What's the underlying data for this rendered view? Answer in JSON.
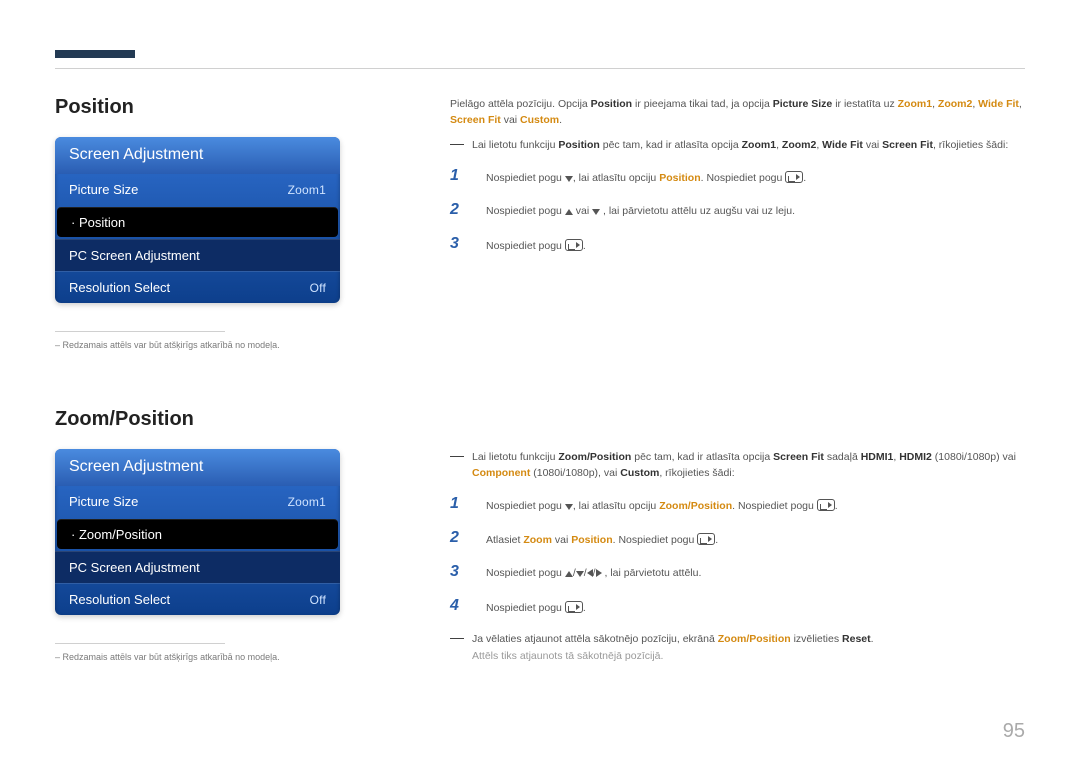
{
  "page_number": "95",
  "position": {
    "heading": "Position",
    "menu": {
      "title": "Screen Adjustment",
      "rows": [
        {
          "label": "Picture Size",
          "value": "Zoom1"
        },
        {
          "label": "· Position",
          "selected": true
        },
        {
          "label": "PC Screen Adjustment"
        },
        {
          "label": "Resolution Select",
          "value": "Off"
        }
      ]
    },
    "image_note": "Redzamais attēls var būt atšķirīgs atkarībā no modeļa.",
    "intro": {
      "t1": "Pielāgo attēla pozīciju. Opcija ",
      "k_position": "Position",
      "t2": " ir pieejama tikai tad, ja opcija ",
      "k_picsize": "Picture Size",
      "t3": " ir iestatīta uz ",
      "k_zoom1": "Zoom1",
      "t4": ", ",
      "k_zoom2": "Zoom2",
      "t5": ", ",
      "k_widefit": "Wide Fit",
      "t6": ", ",
      "k_screenfit": "Screen Fit",
      "t7": " vai ",
      "k_custom": "Custom",
      "t8": "."
    },
    "dash_note": {
      "t1": "Lai lietotu funkciju ",
      "k_position": "Position",
      "t2": " pēc tam, kad ir atlasīta opcija ",
      "k_zoom1": "Zoom1",
      "t3": ", ",
      "k_zoom2": "Zoom2",
      "t4": ", ",
      "k_widefit": "Wide Fit",
      "t5": " vai ",
      "k_screenfit": "Screen Fit",
      "t6": ", rīkojieties šādi:"
    },
    "steps": [
      {
        "num": "1",
        "pre": "Nospiediet pogu ",
        "mid": ", lai atlasītu opciju ",
        "key": "Position",
        "post": ". Nospiediet pogu ",
        "tail": "."
      },
      {
        "num": "2",
        "pre": "Nospiediet pogu ",
        "mid": " vai ",
        "post": " , lai pārvietotu attēlu uz augšu vai uz leju."
      },
      {
        "num": "3",
        "pre": "Nospiediet pogu ",
        "tail": "."
      }
    ]
  },
  "zoom": {
    "heading": "Zoom/Position",
    "menu": {
      "title": "Screen Adjustment",
      "rows": [
        {
          "label": "Picture Size",
          "value": "Zoom1"
        },
        {
          "label": "· Zoom/Position",
          "selected": true
        },
        {
          "label": "PC Screen Adjustment"
        },
        {
          "label": "Resolution Select",
          "value": "Off"
        }
      ]
    },
    "image_note": "Redzamais attēls var būt atšķirīgs atkarībā no modeļa.",
    "dash_note": {
      "t1": "Lai lietotu funkciju ",
      "k_zp": "Zoom/Position",
      "t2": " pēc tam, kad ir atlasīta opcija ",
      "k_sf": "Screen Fit",
      "t3": " sadaļā ",
      "k_h1": "HDMI1",
      "c1": ", ",
      "k_h2": "HDMI2",
      "t4": " (1080i/1080p) vai ",
      "k_comp": "Component",
      "t5": " (1080i/1080p), vai ",
      "k_custom": "Custom",
      "t6": ", rīkojieties šādi:"
    },
    "steps": [
      {
        "num": "1",
        "pre": "Nospiediet pogu ",
        "mid": ", lai atlasītu opciju ",
        "key": "Zoom/Position",
        "post": ". Nospiediet pogu ",
        "tail": "."
      },
      {
        "num": "2",
        "pre": "Atlasiet ",
        "k1": "Zoom",
        "mid": " vai ",
        "k2": "Position",
        "post": ". Nospiediet pogu ",
        "tail": "."
      },
      {
        "num": "3",
        "pre": "Nospiediet pogu ",
        "post": " , lai pārvietotu attēlu."
      },
      {
        "num": "4",
        "pre": "Nospiediet pogu ",
        "tail": "."
      }
    ],
    "reset_note": {
      "t1": "Ja vēlaties atjaunot attēla sākotnējo pozīciju, ekrānā ",
      "k_zp": "Zoom/Position",
      "t2": " izvēlieties ",
      "k_reset": "Reset",
      "t3": ".",
      "line2": "Attēls tiks atjaunots tā sākotnējā pozīcijā."
    }
  }
}
